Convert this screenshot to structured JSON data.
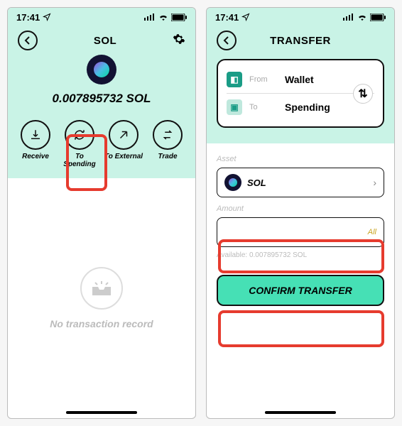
{
  "status": {
    "time": "17:41"
  },
  "left": {
    "title": "SOL",
    "balance": "0.007895732 SOL",
    "actions": {
      "receive": "Receive",
      "to_spending": "To Spending",
      "to_external": "To External",
      "trade": "Trade"
    },
    "empty_tx": "No transaction record"
  },
  "right": {
    "title": "TRANSFER",
    "from_label": "From",
    "from_value": "Wallet",
    "to_label": "To",
    "to_value": "Spending",
    "asset_label": "Asset",
    "asset_value": "SOL",
    "amount_label": "Amount",
    "amount_value": "",
    "all_label": "All",
    "available": "Available: 0.007895732  SOL",
    "confirm": "CONFIRM TRANSFER"
  }
}
